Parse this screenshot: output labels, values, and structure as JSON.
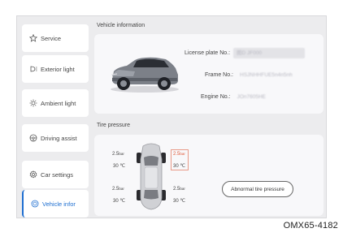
{
  "sidebar": {
    "items": [
      {
        "label": "Service",
        "icon": "star-icon"
      },
      {
        "label": "Exterior light",
        "icon": "headlight-icon"
      },
      {
        "label": "Ambient light",
        "icon": "sun-icon"
      },
      {
        "label": "Driving assist",
        "icon": "steering-wheel-icon"
      },
      {
        "label": "Car settings",
        "icon": "gear-icon"
      },
      {
        "label": "Vehicle infor",
        "icon": "info-icon",
        "active": true
      }
    ]
  },
  "vehicle_info": {
    "title": "Vehicle information",
    "license_label": "License plate No.:",
    "license_value": "图D JF000",
    "frame_label": "Frame No.:",
    "frame_value": "HSJNHHFUE5n4n5nh",
    "engine_label": "Engine No.:",
    "engine_value": "JOn7605HE"
  },
  "tire_pressure": {
    "title": "Tire pressure",
    "front_left": {
      "pressure": "2.5",
      "unit": "bar",
      "temp": "30 ℃"
    },
    "front_right": {
      "pressure": "2.5",
      "unit": "bar",
      "temp": "30 ℃",
      "warning": true
    },
    "rear_left": {
      "pressure": "2.5",
      "unit": "bar",
      "temp": "30 ℃"
    },
    "rear_right": {
      "pressure": "2.5",
      "unit": "bar",
      "temp": "30 ℃"
    },
    "abnormal_button": "Abnormal tire pressure"
  },
  "figure_code": "OMX65-4182",
  "colors": {
    "accent": "#1f6fd1",
    "warning": "#e05a3a"
  }
}
